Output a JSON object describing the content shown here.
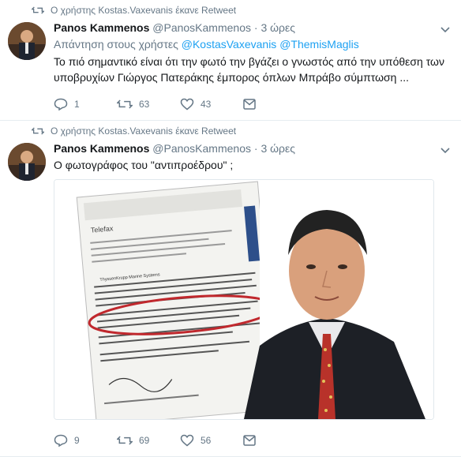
{
  "tweets": [
    {
      "retweet_label": "Ο χρήστης Kostas.Vaxevanis έκανε Retweet",
      "name": "Panos Kammenos",
      "handle": "@PanosKammenos",
      "dot": "·",
      "time": "3 ώρες",
      "reply_prefix": "Απάντηση στους χρήστες",
      "mentions": [
        "@KostasVaxevanis",
        "@ThemisMaglis"
      ],
      "text": "Το πιό σημαντικό είναι ότι την φωτό την βγάζει ο γνωστός από την υπόθεση των υποβρυχίων Γιώργος Πατεράκης έμπορος όπλων Μπράβο σύμπτωση ...",
      "reply_count": "1",
      "retweet_count": "63",
      "like_count": "43"
    },
    {
      "retweet_label": "Ο χρήστης Kostas.Vaxevanis έκανε Retweet",
      "name": "Panos Kammenos",
      "handle": "@PanosKammenos",
      "dot": "·",
      "time": "3 ώρες",
      "text": "Ο φωτογράφος του \"αντιπροέδρου\" ;",
      "reply_count": "9",
      "retweet_count": "69",
      "like_count": "56",
      "media": {
        "doc_company": "ThyssenKrupp Marine Systems",
        "doc_header": "Telefax"
      }
    }
  ],
  "colors": {
    "secondary_text": "#657786",
    "link": "#1da1f2",
    "highlight_red": "#c0282d"
  },
  "icons": [
    "retweet-icon",
    "reply-icon",
    "like-icon",
    "message-icon",
    "chevron-down-icon"
  ]
}
